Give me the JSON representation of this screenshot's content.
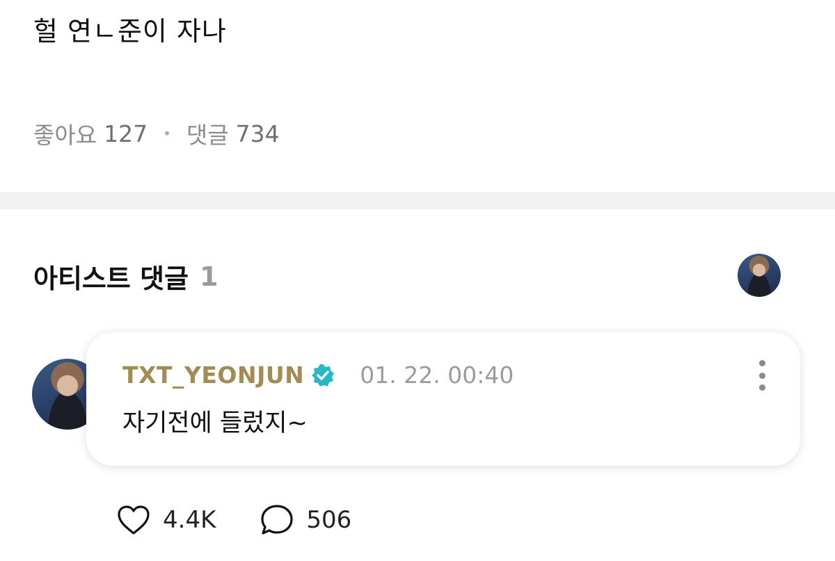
{
  "post": {
    "text": "헐 연ㄴ준이 자나",
    "likes_label": "좋아요",
    "likes_count": "127",
    "comments_label": "댓글",
    "comments_count": "734"
  },
  "artist_comments": {
    "title": "아티스트 댓글",
    "count": "1"
  },
  "comment": {
    "author": "TXT_YEONJUN",
    "timestamp": "01. 22. 00:40",
    "body": "자기전에 들렀지~",
    "likes": "4.4K",
    "replies": "506"
  },
  "colors": {
    "author": "#a38b56",
    "verified": "#27b7c9",
    "muted": "#9b9b9b",
    "divider": "#f2f2f3"
  },
  "icons": [
    "verified-badge-icon",
    "more-vertical-icon",
    "heart-icon",
    "comment-bubble-icon"
  ]
}
